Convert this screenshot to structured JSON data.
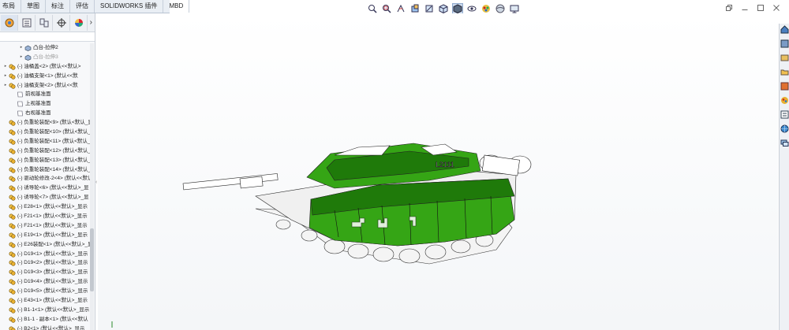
{
  "menu_tabs": [
    "布局",
    "草图",
    "标注",
    "评估",
    "SOLIDWORKS 插件",
    "MBD"
  ],
  "feature_tree": [
    {
      "label": "凸台-拉伸2",
      "indent": 2,
      "icon": "feature-icon",
      "state": "normal",
      "twisty": "collapsed"
    },
    {
      "label": "凸台-拉伸3",
      "indent": 2,
      "icon": "feature-icon",
      "state": "suppressed",
      "twisty": "collapsed"
    },
    {
      "label": "(-) 油桶盖<2> (默认<<默认>",
      "indent": 0,
      "icon": "assembly-icon",
      "state": "normal",
      "twisty": "collapsed"
    },
    {
      "label": "(-) 油桶支架<1> (默认<<默",
      "indent": 0,
      "icon": "assembly-icon",
      "state": "normal",
      "twisty": "collapsed"
    },
    {
      "label": "(-) 油桶支架<2> (默认<<默",
      "indent": 0,
      "icon": "assembly-icon",
      "state": "normal",
      "twisty": "collapsed"
    },
    {
      "label": "前视基准面",
      "indent": 1,
      "icon": "plane-icon",
      "state": "normal",
      "twisty": "none"
    },
    {
      "label": "上视基准面",
      "indent": 1,
      "icon": "plane-icon",
      "state": "normal",
      "twisty": "none"
    },
    {
      "label": "右视基准面",
      "indent": 1,
      "icon": "plane-icon",
      "state": "normal",
      "twisty": "none"
    },
    {
      "label": "(-) 负重轮装配<9> (默认<默认_显",
      "indent": 0,
      "icon": "assembly-icon",
      "state": "normal",
      "twisty": "none"
    },
    {
      "label": "(-) 负重轮装配<10> (默认<默认_",
      "indent": 0,
      "icon": "assembly-icon",
      "state": "normal",
      "twisty": "none"
    },
    {
      "label": "(-) 负重轮装配<11> (默认<默认_",
      "indent": 0,
      "icon": "assembly-icon",
      "state": "normal",
      "twisty": "none"
    },
    {
      "label": "(-) 负重轮装配<12> (默认<默认_",
      "indent": 0,
      "icon": "assembly-icon",
      "state": "normal",
      "twisty": "none"
    },
    {
      "label": "(-) 负重轮装配<13> (默认<默认_",
      "indent": 0,
      "icon": "assembly-icon",
      "state": "normal",
      "twisty": "none"
    },
    {
      "label": "(-) 负重轮装配<14> (默认<默认_",
      "indent": 0,
      "icon": "assembly-icon",
      "state": "normal",
      "twisty": "none"
    },
    {
      "label": "(-) 驱动轮修改-2<4> (默认<<默认",
      "indent": 0,
      "icon": "assembly-icon",
      "state": "normal",
      "twisty": "none"
    },
    {
      "label": "(-) 诱导轮<6> (默认<<默认>_显",
      "indent": 0,
      "icon": "assembly-icon",
      "state": "normal",
      "twisty": "none"
    },
    {
      "label": "(-) 诱导轮<7> (默认<<默认>_显",
      "indent": 0,
      "icon": "assembly-icon",
      "state": "normal",
      "twisty": "none"
    },
    {
      "label": "(-) E28<1> (默认<<默认>_显示",
      "indent": 0,
      "icon": "assembly-icon",
      "state": "normal",
      "twisty": "none"
    },
    {
      "label": "(-) F21<1> (默认<<默认>_显示",
      "indent": 0,
      "icon": "assembly-icon",
      "state": "normal",
      "twisty": "none"
    },
    {
      "label": "(-) F21<1> (默认<<默认>_显示",
      "indent": 0,
      "icon": "assembly-icon",
      "state": "normal",
      "twisty": "none"
    },
    {
      "label": "(-) E19<1> (默认<<默认>_显示",
      "indent": 0,
      "icon": "assembly-icon",
      "state": "normal",
      "twisty": "none"
    },
    {
      "label": "(-) E26装配<1> (默认<<默认>_显",
      "indent": 0,
      "icon": "assembly-icon",
      "state": "normal",
      "twisty": "none"
    },
    {
      "label": "(-) D19<1> (默认<<默认>_显示",
      "indent": 0,
      "icon": "assembly-icon",
      "state": "normal",
      "twisty": "none"
    },
    {
      "label": "(-) D19<2> (默认<<默认>_显示",
      "indent": 0,
      "icon": "assembly-icon",
      "state": "normal",
      "twisty": "none"
    },
    {
      "label": "(-) D19<3> (默认<<默认>_显示",
      "indent": 0,
      "icon": "assembly-icon",
      "state": "normal",
      "twisty": "none"
    },
    {
      "label": "(-) D19<4> (默认<<默认>_显示",
      "indent": 0,
      "icon": "assembly-icon",
      "state": "normal",
      "twisty": "none"
    },
    {
      "label": "(-) D19<5> (默认<<默认>_显示",
      "indent": 0,
      "icon": "assembly-icon",
      "state": "normal",
      "twisty": "none"
    },
    {
      "label": "(-) E43<1> (默认<<默认>_显示",
      "indent": 0,
      "icon": "assembly-icon",
      "state": "normal",
      "twisty": "none"
    },
    {
      "label": "(-) B1-1<1> (默认<<默认>_显示",
      "indent": 0,
      "icon": "assembly-icon",
      "state": "normal",
      "twisty": "none"
    },
    {
      "label": "(-) B1-1 - 副本<1> (默认<<默认",
      "indent": 0,
      "icon": "assembly-icon",
      "state": "normal",
      "twisty": "none"
    },
    {
      "label": "(-) B2<1> (默认<<默认>_显示",
      "indent": 0,
      "icon": "assembly-icon",
      "state": "normal",
      "twisty": "none"
    }
  ],
  "model": {
    "hull_marking": "L2111",
    "colors": {
      "armor_green": "#35a515",
      "armor_dark": "#1f7a0a",
      "line": "#222222",
      "white_parts": "#f4f4f4"
    }
  },
  "colors": {
    "accent": "#2b6cb0",
    "panel_bg": "#f7f8fa"
  }
}
